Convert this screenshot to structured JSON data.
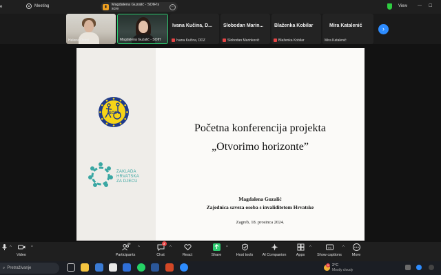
{
  "topbar": {
    "clipped_left": "e",
    "meeting_label": "Meeting",
    "share_label": "Magdalena Guzalić - SOIH's scre",
    "view_label": "View"
  },
  "participants": [
    {
      "name": "Helena Ostoš",
      "video": true
    },
    {
      "name": "Magdalena Guzalić - SOIH",
      "video": true,
      "active": true
    },
    {
      "display": "Ivana Kučina, D...",
      "name": "Ivana Kučina, DDZ",
      "muted": true
    },
    {
      "display": "Slobodan Marin...",
      "name": "Slobodan Marinković",
      "muted": true
    },
    {
      "display": "Blaženka Kobilar",
      "name": "Blaženka Kobilar",
      "muted": true
    },
    {
      "display": "Mira Katalenić",
      "name": "Mira Katalenić",
      "muted": false
    }
  ],
  "slide": {
    "title_line1": "Početna konferencija projekta",
    "title_line2": "„Otvorimo horizonte”",
    "author": "Magdalena Guzalić",
    "organization": "Zajednica saveza osoba s invaliditetom Hrvatske",
    "date": "Zagreb, 18. prosinca 2024.",
    "logo1_text": "SOIH",
    "logo2_lines": [
      "ZAKLADA",
      "HRVATSKA",
      "ZA DJECU"
    ]
  },
  "toolbar": {
    "video": "Video",
    "participants": "Participants",
    "participants_count": "39",
    "chat": "Chat",
    "chat_badge": "3",
    "react": "React",
    "share": "Share",
    "host_tools": "Host tools",
    "ai_companion": "AI Companion",
    "apps": "Apps",
    "captions": "Show captions",
    "more": "More"
  },
  "taskbar": {
    "search_placeholder": "Pretraživanje",
    "temperature": "2°C",
    "weather_desc": "Mostly cloudy",
    "weather_alert": "1"
  },
  "colors": {
    "accent_blue": "#2d8cff",
    "active_green": "#2ecc71",
    "muted_red": "#e64545",
    "teal_logo": "#3aa7a3"
  }
}
